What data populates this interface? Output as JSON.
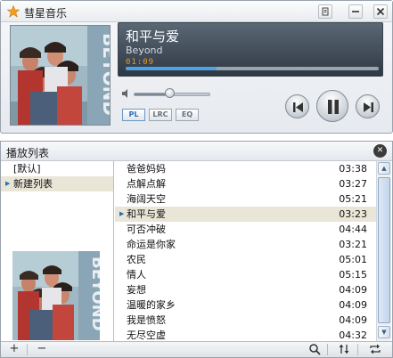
{
  "app": {
    "title": "彗星音乐"
  },
  "titlebar": {
    "menu_icon": "menu-icon",
    "minimize_icon": "minimize-icon",
    "close_icon": "close-icon"
  },
  "now_playing": {
    "title": "和平与爱",
    "artist": "Beyond",
    "elapsed": "01:09",
    "progress_fraction": 0.36
  },
  "volume": {
    "level_fraction": 0.48
  },
  "mode_buttons": [
    "PL",
    "LRC",
    "EQ"
  ],
  "album_art": {
    "band_text": "BEYOND"
  },
  "playlist_panel": {
    "title": "播放列表",
    "lists": [
      {
        "label": "[默认]",
        "selected": false
      },
      {
        "label": "新建列表",
        "selected": true
      }
    ],
    "tracks": [
      {
        "name": "爸爸妈妈",
        "duration": "03:38",
        "playing": false
      },
      {
        "name": "点解点解",
        "duration": "03:27",
        "playing": false
      },
      {
        "name": "海阔天空",
        "duration": "05:21",
        "playing": false
      },
      {
        "name": "和平与爱",
        "duration": "03:23",
        "playing": true
      },
      {
        "name": "可否冲破",
        "duration": "04:44",
        "playing": false
      },
      {
        "name": "命运是你家",
        "duration": "03:21",
        "playing": false
      },
      {
        "name": "农民",
        "duration": "05:01",
        "playing": false
      },
      {
        "name": "情人",
        "duration": "05:15",
        "playing": false
      },
      {
        "name": "妄想",
        "duration": "04:09",
        "playing": false
      },
      {
        "name": "温暖的家乡",
        "duration": "04:09",
        "playing": false
      },
      {
        "name": "我是愤怒",
        "duration": "04:09",
        "playing": false
      },
      {
        "name": "无尽空虚",
        "duration": "04:32",
        "playing": false
      }
    ]
  },
  "footer": {
    "add_label": "+",
    "remove_label": "−",
    "search_icon": "search-icon",
    "sort_icon": "sort-icon",
    "repeat_icon": "repeat-icon"
  },
  "colors": {
    "accent": "#2d6fb8",
    "progress": "#4da2e6",
    "time": "#f29a1e",
    "selection": "#e9e6d8"
  }
}
